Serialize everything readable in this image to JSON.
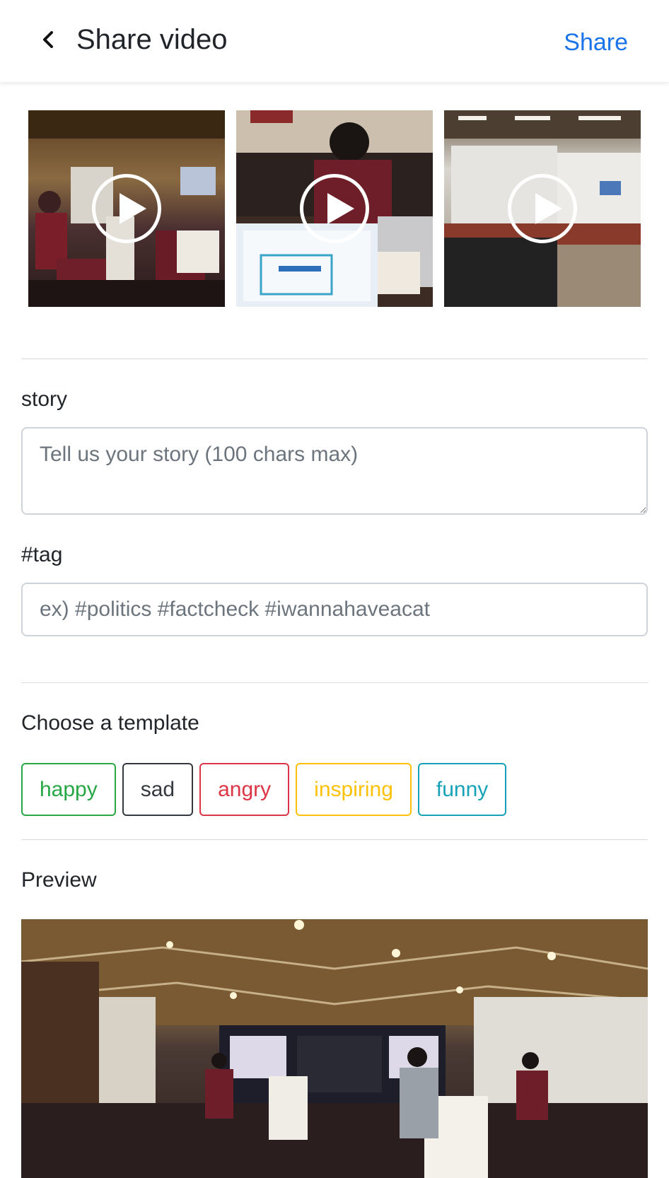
{
  "header": {
    "title": "Share video",
    "share_label": "Share"
  },
  "thumbnails": [
    {
      "name": "seoul editors lab room"
    },
    {
      "name": "participant at laptop"
    },
    {
      "name": "event hall wide"
    }
  ],
  "story": {
    "label": "story",
    "placeholder": "Tell us your story (100 chars max)",
    "value": ""
  },
  "tag": {
    "label": "#tag",
    "placeholder": "ex) #politics #factcheck #iwannahaveacat",
    "value": ""
  },
  "templates": {
    "label": "Choose a template",
    "items": [
      {
        "label": "happy",
        "color": "#28a745"
      },
      {
        "label": "sad",
        "color": "#343a40"
      },
      {
        "label": "angry",
        "color": "#dc3545"
      },
      {
        "label": "inspiring",
        "color": "#ffc107"
      },
      {
        "label": "funny",
        "color": "#17a2b8"
      }
    ]
  },
  "preview": {
    "label": "Preview"
  }
}
